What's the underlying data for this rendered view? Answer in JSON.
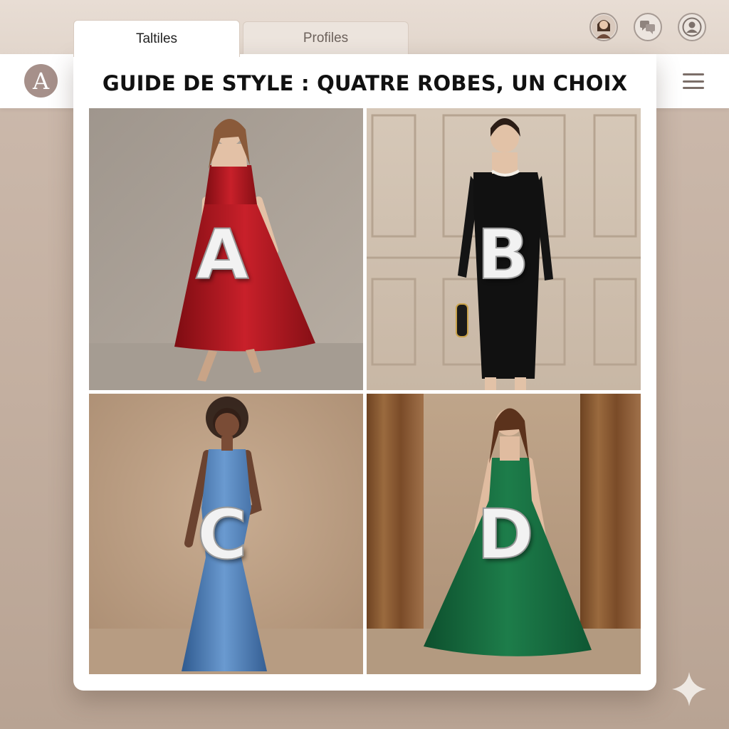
{
  "tabs": [
    {
      "label": "Taltiles",
      "active": true
    },
    {
      "label": "Profiles",
      "active": false
    }
  ],
  "logo": {
    "letter": "A"
  },
  "header_icons": [
    "profile-photo-icon",
    "chat-bubbles-icon",
    "user-account-icon"
  ],
  "page_title": "GUIDE DE STYLE : QUATRE ROBES, UN CHOIX",
  "options": [
    {
      "letter": "A",
      "dress_color": "#b3141a"
    },
    {
      "letter": "B",
      "dress_color": "#111111"
    },
    {
      "letter": "C",
      "dress_color": "#4a77b0"
    },
    {
      "letter": "D",
      "dress_color": "#136b3f"
    }
  ],
  "colors": {
    "accent": "#a6908a",
    "background": "#cdbbae"
  }
}
